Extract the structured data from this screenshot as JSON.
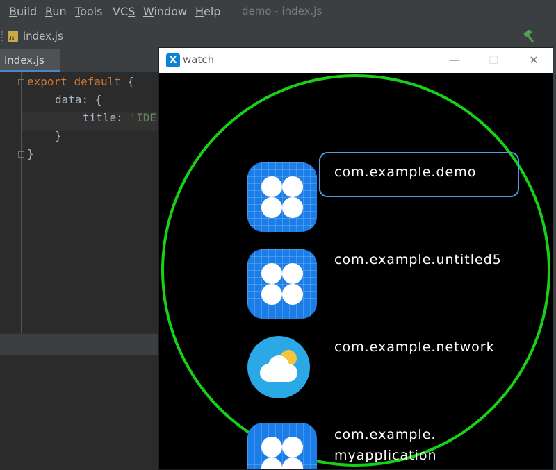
{
  "menu": {
    "items": [
      {
        "u": "B",
        "rest": "uild"
      },
      {
        "u": "R",
        "rest": "un"
      },
      {
        "u": "T",
        "rest": "ools"
      },
      {
        "pre": "VC",
        "u": "S",
        "rest": ""
      },
      {
        "u": "W",
        "rest": "indow"
      },
      {
        "u": "H",
        "rest": "elp"
      }
    ],
    "window_title": "demo - index.js"
  },
  "nav": {
    "file": "index.js"
  },
  "tab": {
    "label": "index.js"
  },
  "code": {
    "line1_kw1": "export",
    "line1_kw2": "default",
    "line1_rest": " {",
    "line2": "data: {",
    "line3_key": "title: ",
    "line3_str": "'IDE",
    "line4": "}",
    "line5": "}"
  },
  "watch": {
    "logo": "X",
    "title": "watch",
    "minimize": "—",
    "maximize": "☐",
    "close": "✕",
    "apps": [
      {
        "label": "com.example.demo",
        "icon": "grid-flower-icon"
      },
      {
        "label": "com.example.untitled5",
        "icon": "grid-flower-icon"
      },
      {
        "label": "com.example.network",
        "icon": "weather-icon"
      },
      {
        "label_line1": "com.example.",
        "label_line2": "myapplication",
        "icon": "grid-flower-icon"
      }
    ]
  },
  "colors": {
    "ring": "#16d116",
    "focus": "#4d9fe3",
    "app_blue": "#1b7de8"
  }
}
